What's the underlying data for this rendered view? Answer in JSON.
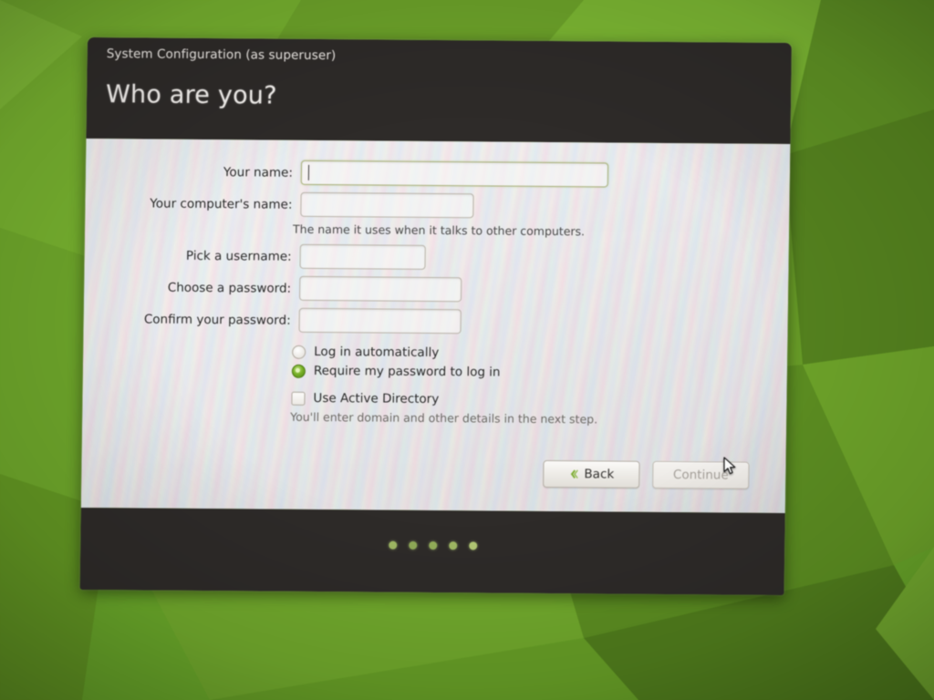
{
  "window": {
    "titlebar_text": "System Configuration (as superuser)",
    "page_title": "Who are you?"
  },
  "form": {
    "fields": [
      {
        "label": "Your name:",
        "value": "",
        "focused": true
      },
      {
        "label": "Your computer's name:",
        "value": "",
        "focused": false
      },
      {
        "label": "Pick a username:",
        "value": "",
        "focused": false
      },
      {
        "label": "Choose a password:",
        "value": "",
        "focused": false
      },
      {
        "label": "Confirm your password:",
        "value": "",
        "focused": false
      }
    ],
    "computer_name_hint": "The name it uses when it talks to other computers.",
    "login_options": [
      {
        "label": "Log in automatically",
        "selected": false
      },
      {
        "label": "Require my password to log in",
        "selected": true
      }
    ],
    "active_directory": {
      "label": "Use Active Directory",
      "checked": false,
      "hint": "You'll enter domain and other details in the next step."
    }
  },
  "buttons": {
    "back": "Back",
    "continue": "Continue",
    "continue_disabled": true
  },
  "footer": {
    "progress_dots": 5
  },
  "colors": {
    "accent_green": "#79b128",
    "titlebar": "#2e2b29",
    "body": "#f2f0ee",
    "wallpaper": "#6aa82a",
    "dot": "#9fb763"
  },
  "icons": {
    "back_chevron": "chevron-left-icon",
    "cursor": "mouse-pointer-icon"
  }
}
